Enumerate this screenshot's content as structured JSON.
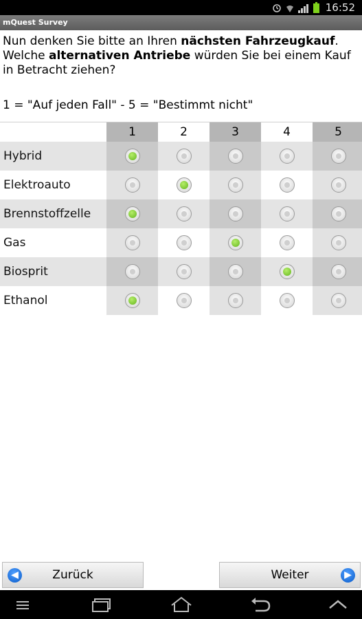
{
  "status_bar": {
    "time": "16:52",
    "icons": [
      "alarm-icon",
      "wifi-icon",
      "signal-icon",
      "battery-icon"
    ]
  },
  "app": {
    "title": "mQuest Survey"
  },
  "question": {
    "part1": "Nun denken Sie bitte an Ihren ",
    "bold1": "nächsten Fahrzeugkauf",
    "part2": ". Welche ",
    "bold2": "alternativen Antriebe",
    "part3": " würden Sie bei einem Kauf in Betracht ziehen?",
    "scale_hint": "1 = \"Auf jeden Fall\" - 5 = \"Bestimmt nicht\""
  },
  "matrix": {
    "columns": [
      "1",
      "2",
      "3",
      "4",
      "5"
    ],
    "rows": [
      {
        "label": "Hybrid",
        "selected": 1
      },
      {
        "label": "Elektroauto",
        "selected": 2
      },
      {
        "label": "Brennstoffzelle",
        "selected": 1
      },
      {
        "label": "Gas",
        "selected": 3
      },
      {
        "label": "Biosprit",
        "selected": 4
      },
      {
        "label": "Ethanol",
        "selected": 1
      }
    ]
  },
  "buttons": {
    "back": "Zurück",
    "next": "Weiter",
    "back_icon": "arrow-left-icon",
    "next_icon": "arrow-right-icon"
  },
  "colors": {
    "selected_radio": "#7ccf2a",
    "button_icon": "#1565d8",
    "dark_column": "#b5b5b5"
  }
}
